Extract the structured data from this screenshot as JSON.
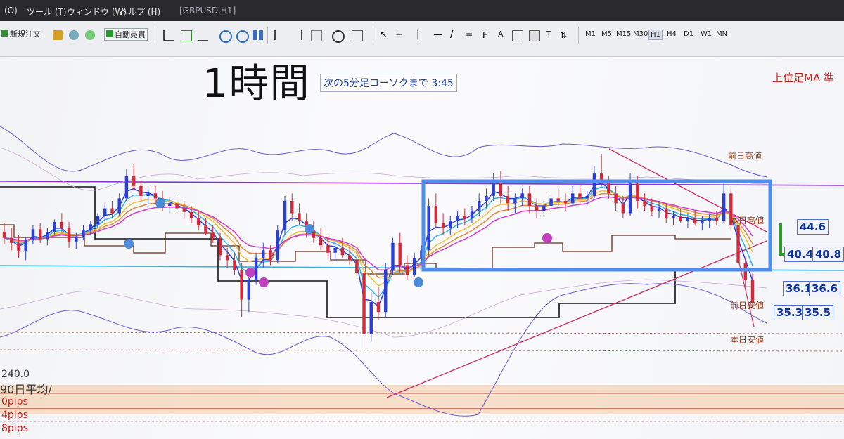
{
  "menubar": {
    "items": [
      "(O)",
      "ツール (T)",
      "ウィンドウ (W)",
      "ヘルプ (H)"
    ],
    "title": "[GBPUSD,H1]"
  },
  "toolbar": {
    "new_order": "新規注文",
    "auto_trade": "自動売買",
    "timeframes": [
      "M1",
      "M5",
      "M15",
      "M30",
      "H1",
      "H4",
      "D1",
      "W1",
      "MN"
    ],
    "active_timeframe": "H1",
    "tool_letters": [
      "A",
      "T"
    ]
  },
  "overlay": {
    "title": "1時間",
    "countdown": "次の5分足ローソクまで 3:45",
    "top_right": "上位足MA 準"
  },
  "levels": {
    "prev_high": "前日高値",
    "today_high": "本日高値",
    "prev_low": "前日安値",
    "today_low": "本日安値"
  },
  "price_boxes": {
    "p1": "44.6",
    "p2": "40.4",
    "p3": "40.8",
    "p4": "36.1",
    "p5": "36.6",
    "p6": "35.3",
    "p7": "35.5"
  },
  "bottom_labels": {
    "value": "240.0",
    "ma": "90日平均/",
    "pips1": "0pips",
    "pips2": "4pips",
    "pips3": "8pips"
  },
  "colors": {
    "highlight_box": "#4f8ef0",
    "purple_line": "#8a2be2",
    "cyan_line": "#31b3e6",
    "red_trend": "#d0306a",
    "black_line": "#111111",
    "band": "#f4c9a0",
    "up_candle": "#2b3fd6",
    "down_candle": "#d7283a"
  },
  "chart_data": {
    "type": "candlestick",
    "title": "1時間",
    "timeframe": "H1",
    "price_ticks": [
      "44.6",
      "40.4",
      "40.8",
      "36.1",
      "36.6",
      "35.3",
      "35.5"
    ],
    "levels": [
      "前日高値",
      "本日高値",
      "前日安値",
      "本日安値"
    ],
    "axes": {
      "y_visible_range": [
        34.8,
        45.6
      ]
    },
    "candles": [
      [
        42.05,
        42.4,
        41.55,
        41.8
      ],
      [
        41.8,
        42.2,
        41.3,
        41.6
      ],
      [
        41.6,
        41.9,
        41.0,
        41.25
      ],
      [
        41.25,
        41.85,
        40.9,
        41.7
      ],
      [
        41.7,
        42.3,
        41.55,
        42.15
      ],
      [
        42.15,
        42.4,
        41.6,
        41.75
      ],
      [
        41.75,
        42.2,
        41.5,
        42.05
      ],
      [
        42.05,
        42.55,
        41.9,
        42.45
      ],
      [
        42.45,
        42.8,
        42.0,
        42.2
      ],
      [
        42.2,
        42.45,
        41.4,
        41.65
      ],
      [
        41.65,
        42.0,
        41.35,
        41.85
      ],
      [
        41.85,
        42.3,
        41.7,
        42.1
      ],
      [
        42.1,
        42.5,
        41.9,
        42.35
      ],
      [
        42.35,
        42.8,
        42.2,
        42.7
      ],
      [
        42.7,
        43.2,
        42.5,
        43.0
      ],
      [
        43.0,
        43.3,
        42.6,
        42.8
      ],
      [
        42.8,
        43.6,
        42.7,
        43.4
      ],
      [
        43.4,
        44.6,
        43.3,
        44.3
      ],
      [
        44.3,
        44.8,
        43.7,
        43.9
      ],
      [
        43.9,
        44.1,
        43.3,
        43.5
      ],
      [
        43.5,
        43.8,
        43.1,
        43.6
      ],
      [
        43.6,
        43.9,
        43.2,
        43.4
      ],
      [
        43.4,
        43.7,
        42.9,
        43.1
      ],
      [
        43.1,
        43.4,
        42.8,
        43.2
      ],
      [
        43.2,
        43.5,
        42.9,
        43.0
      ],
      [
        43.0,
        43.3,
        42.6,
        42.85
      ],
      [
        42.85,
        43.1,
        42.4,
        42.6
      ],
      [
        42.6,
        42.9,
        42.1,
        42.3
      ],
      [
        42.3,
        42.6,
        41.9,
        42.0
      ],
      [
        42.0,
        42.3,
        41.6,
        41.8
      ],
      [
        41.8,
        42.0,
        40.9,
        41.1
      ],
      [
        41.1,
        41.4,
        40.6,
        40.9
      ],
      [
        40.9,
        41.2,
        40.3,
        40.5
      ],
      [
        40.5,
        40.8,
        38.6,
        39.3
      ],
      [
        39.3,
        40.4,
        38.8,
        40.1
      ],
      [
        40.1,
        41.2,
        39.9,
        41.0
      ],
      [
        41.0,
        41.6,
        40.6,
        41.3
      ],
      [
        41.3,
        41.5,
        40.7,
        40.9
      ],
      [
        40.9,
        42.3,
        40.8,
        42.1
      ],
      [
        42.1,
        43.5,
        41.9,
        43.3
      ],
      [
        43.3,
        43.6,
        42.5,
        42.8
      ],
      [
        42.8,
        43.2,
        42.3,
        42.5
      ],
      [
        42.5,
        42.8,
        41.8,
        42.1
      ],
      [
        42.1,
        42.5,
        41.6,
        41.8
      ],
      [
        41.8,
        42.2,
        41.3,
        41.5
      ],
      [
        41.5,
        41.9,
        41.0,
        41.2
      ],
      [
        41.2,
        41.7,
        40.9,
        41.4
      ],
      [
        41.4,
        41.8,
        41.0,
        41.1
      ],
      [
        41.1,
        41.5,
        40.7,
        40.9
      ],
      [
        40.9,
        41.3,
        40.2,
        40.4
      ],
      [
        40.4,
        40.7,
        37.3,
        37.9
      ],
      [
        37.9,
        39.6,
        37.6,
        39.2
      ],
      [
        39.2,
        39.8,
        38.5,
        38.8
      ],
      [
        38.8,
        40.8,
        38.6,
        40.5
      ],
      [
        40.5,
        41.8,
        40.3,
        41.6
      ],
      [
        41.6,
        42.0,
        40.4,
        40.7
      ],
      [
        40.7,
        41.1,
        40.1,
        40.3
      ],
      [
        40.3,
        41.2,
        40.2,
        41.0
      ],
      [
        41.0,
        41.5,
        40.8,
        41.3
      ],
      [
        41.3,
        43.4,
        41.1,
        43.1
      ],
      [
        43.1,
        43.6,
        42.2,
        42.4
      ],
      [
        42.4,
        42.8,
        41.9,
        42.2
      ],
      [
        42.2,
        42.7,
        41.9,
        42.5
      ],
      [
        42.5,
        42.9,
        42.2,
        42.7
      ],
      [
        42.7,
        43.0,
        42.3,
        42.6
      ],
      [
        42.6,
        43.1,
        42.4,
        42.9
      ],
      [
        42.9,
        43.6,
        42.7,
        43.3
      ],
      [
        43.3,
        43.8,
        43.0,
        43.5
      ],
      [
        43.5,
        44.4,
        43.3,
        44.1
      ],
      [
        44.1,
        44.5,
        43.2,
        43.5
      ],
      [
        43.5,
        43.9,
        42.9,
        43.2
      ],
      [
        43.2,
        43.6,
        42.8,
        43.4
      ],
      [
        43.4,
        43.8,
        43.1,
        43.6
      ],
      [
        43.6,
        43.9,
        42.8,
        43.1
      ],
      [
        43.1,
        43.4,
        42.6,
        42.9
      ],
      [
        42.9,
        43.3,
        42.7,
        43.1
      ],
      [
        43.1,
        43.6,
        42.9,
        43.4
      ],
      [
        43.4,
        43.8,
        43.1,
        43.3
      ],
      [
        43.3,
        43.6,
        42.9,
        43.2
      ],
      [
        43.2,
        43.9,
        43.1,
        43.6
      ],
      [
        43.6,
        43.9,
        43.2,
        43.4
      ],
      [
        43.4,
        43.7,
        43.1,
        43.5
      ],
      [
        43.5,
        44.7,
        43.4,
        44.4
      ],
      [
        44.4,
        45.2,
        43.9,
        44.1
      ],
      [
        44.1,
        44.3,
        43.4,
        43.6
      ],
      [
        43.6,
        43.9,
        42.9,
        43.2
      ],
      [
        43.2,
        43.5,
        42.6,
        42.8
      ],
      [
        42.8,
        44.4,
        42.7,
        44.0
      ],
      [
        44.0,
        44.3,
        43.0,
        43.3
      ],
      [
        43.3,
        43.6,
        42.9,
        43.1
      ],
      [
        43.1,
        43.4,
        42.7,
        42.9
      ],
      [
        42.9,
        43.3,
        42.6,
        43.0
      ],
      [
        43.0,
        43.2,
        42.4,
        42.6
      ],
      [
        42.6,
        42.9,
        42.3,
        42.7
      ],
      [
        42.7,
        43.0,
        42.4,
        42.5
      ],
      [
        42.5,
        42.8,
        42.2,
        42.6
      ],
      [
        42.6,
        42.9,
        42.3,
        42.4
      ],
      [
        42.4,
        42.7,
        42.1,
        42.5
      ],
      [
        42.5,
        42.8,
        42.2,
        42.6
      ],
      [
        42.6,
        42.9,
        42.3,
        42.5
      ],
      [
        42.5,
        44.0,
        42.4,
        43.6
      ],
      [
        43.6,
        43.8,
        42.1,
        42.3
      ],
      [
        42.3,
        42.5,
        40.4,
        40.8
      ],
      [
        40.8,
        41.0,
        39.8,
        40.1
      ],
      [
        40.1,
        40.4,
        39.0,
        39.2
      ]
    ],
    "series": [
      {
        "name": "",
        "color": "#2b3fd6"
      },
      {
        "name": "",
        "color": "#31b3e6"
      },
      {
        "name": "",
        "color": "#f0c030"
      },
      {
        "name": "",
        "color": "#e08a3c"
      },
      {
        "name": "",
        "color": "#d43ad4"
      },
      {
        "name": "",
        "color": "#6b2a18"
      },
      {
        "name": "",
        "color": "#111111"
      }
    ]
  }
}
